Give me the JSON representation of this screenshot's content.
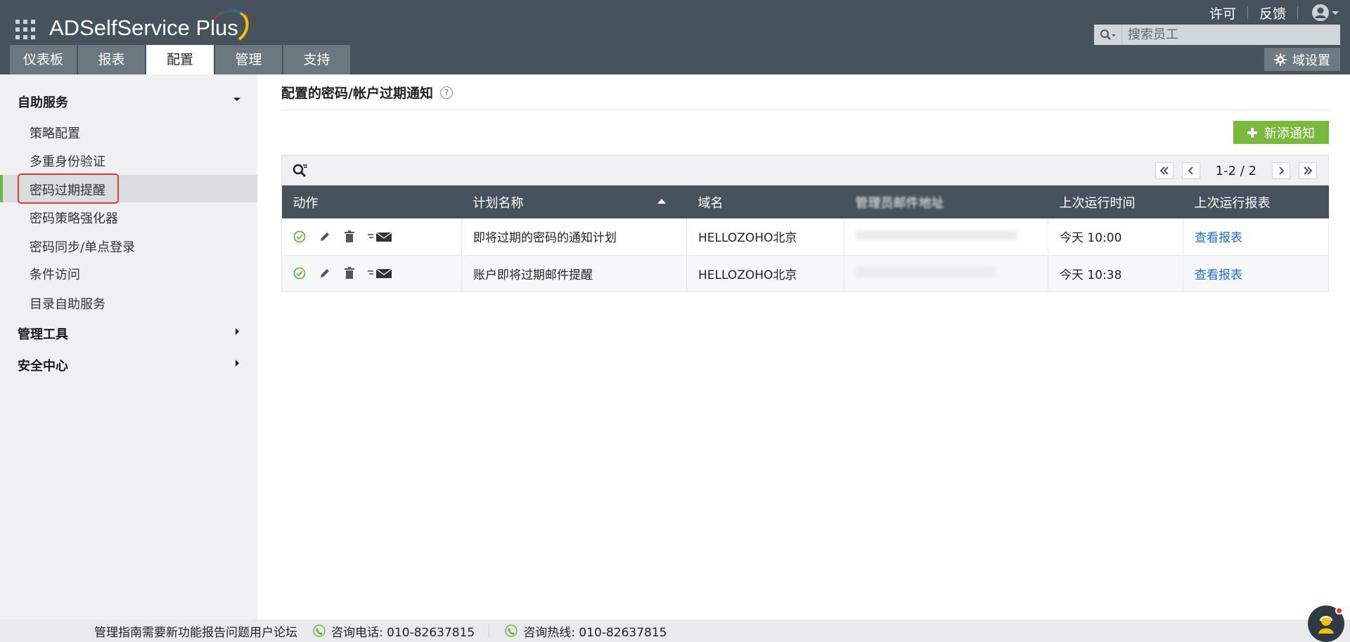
{
  "app": {
    "logo_text": "ADSelfService Plus",
    "top_links": {
      "license": "许可",
      "feedback": "反馈"
    },
    "search_placeholder": "搜索员工",
    "tabs": [
      {
        "label": "仪表板"
      },
      {
        "label": "报表"
      },
      {
        "label": "配置",
        "active": true
      },
      {
        "label": "管理"
      },
      {
        "label": "支持"
      }
    ],
    "domain_settings_label": "域设置"
  },
  "sidebar": {
    "sections": [
      {
        "title": "自助服务",
        "expanded": true
      },
      {
        "title": "管理工具",
        "expanded": false
      },
      {
        "title": "安全中心",
        "expanded": false
      }
    ],
    "items": [
      {
        "label": "策略配置"
      },
      {
        "label": "多重身份验证"
      },
      {
        "label": "密码过期提醒",
        "active": true
      },
      {
        "label": "密码策略强化器"
      },
      {
        "label": "密码同步/单点登录"
      },
      {
        "label": "条件访问"
      },
      {
        "label": "目录自助服务"
      }
    ]
  },
  "main": {
    "title": "配置的密码/帐户过期通知",
    "help": "?",
    "new_button": "新添通知",
    "pager_info": "1-2 / 2",
    "columns": [
      "动作",
      "计划名称",
      "域名",
      "管理员邮件地址",
      "上次运行时间",
      "上次运行报表"
    ],
    "rows": [
      {
        "name": "即将过期的密码的通知计划",
        "domain": "HELLOZOHO北京",
        "last_run": "今天 10:00",
        "report": "查看报表"
      },
      {
        "name": "账户即将过期邮件提醒",
        "domain": "HELLOZOHO北京",
        "last_run": "今天 10:38",
        "report": "查看报表"
      }
    ]
  },
  "footer": {
    "links": "管理指南需要新功能报告问题用户论坛",
    "phone": "咨询电话: 010-82637815",
    "hotline": "咨询热线: 010-82637815"
  },
  "colors": {
    "header": "#46535c",
    "accent_green": "#79b93c",
    "link_blue": "#1f6fc6",
    "highlight_red": "#e53935"
  }
}
